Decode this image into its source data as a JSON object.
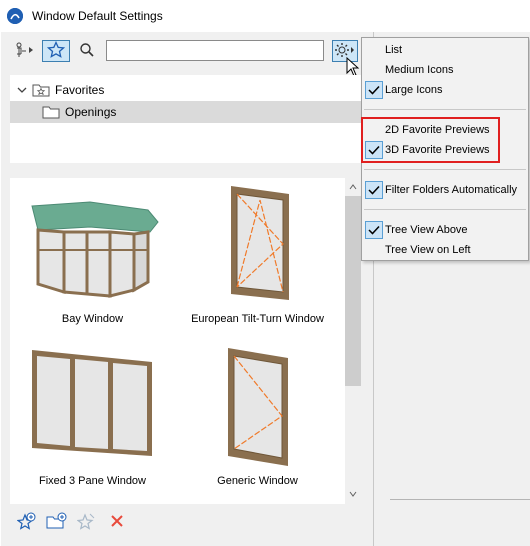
{
  "window": {
    "title": "Window Default Settings"
  },
  "toolbar": {
    "search_value": "",
    "icons": [
      "hierarchy-icon",
      "star-icon",
      "search-icon",
      "gear-icon"
    ]
  },
  "tree": {
    "items": [
      {
        "label": "Favorites",
        "expanded": true,
        "selected": false
      },
      {
        "label": "Openings",
        "selected": true
      }
    ]
  },
  "favorites": {
    "items": [
      {
        "label": "Bay Window"
      },
      {
        "label": "European Tilt-Turn Window"
      },
      {
        "label": "Fixed 3 Pane Window"
      },
      {
        "label": "Generic Window"
      }
    ]
  },
  "menu": {
    "items": [
      {
        "label": "List",
        "checked": false
      },
      {
        "label": "Medium Icons",
        "checked": false
      },
      {
        "label": "Large Icons",
        "checked": true
      },
      {
        "label": "2D Favorite Previews",
        "checked": false
      },
      {
        "label": "3D Favorite Previews",
        "checked": true
      },
      {
        "label": "Filter Folders Automatically",
        "checked": true
      },
      {
        "label": "Tree View Above",
        "checked": true
      },
      {
        "label": "Tree View on Left",
        "checked": false
      }
    ]
  },
  "bottom_toolbar": {
    "icons": [
      "add-favorite-icon",
      "new-folder-icon",
      "favorite-disabled-icon",
      "delete-icon"
    ]
  },
  "colors": {
    "accent": "#1f5fb3",
    "highlight_border": "#e01f1f",
    "selection": "#dadada",
    "delete": "#e84a3c"
  }
}
